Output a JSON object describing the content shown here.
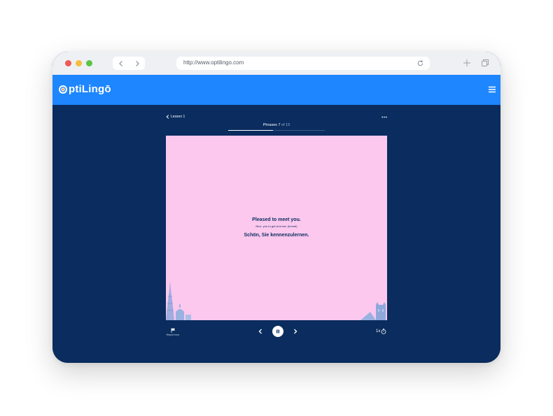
{
  "browser": {
    "url": "http://www.optilingo.com",
    "icons": [
      "back-icon",
      "forward-icon",
      "reload-icon",
      "new-tab-icon",
      "tabs-icon"
    ]
  },
  "app": {
    "brand": "ptiLingō",
    "brand_color": "#1e86ff",
    "background_color": "#0a2c5e",
    "menu_icon": "hamburger-icon"
  },
  "lesson": {
    "back_label": "Lesson 1",
    "progress_prefix": "Phrases",
    "current": "7",
    "total_text": "of 15",
    "progress_fraction": 0.4667
  },
  "card": {
    "background_color": "#fcc8ee",
    "english": "Pleased to meet you.",
    "literal": "Nice, you to-get-to-know. (formal)",
    "german": "Schön, Sie kennenzulernen."
  },
  "controls": {
    "report_label": "Report error",
    "speed": "1x",
    "icons": [
      "flag-icon",
      "chevron-left-icon",
      "pause-icon",
      "chevron-right-icon",
      "timer-icon"
    ]
  }
}
